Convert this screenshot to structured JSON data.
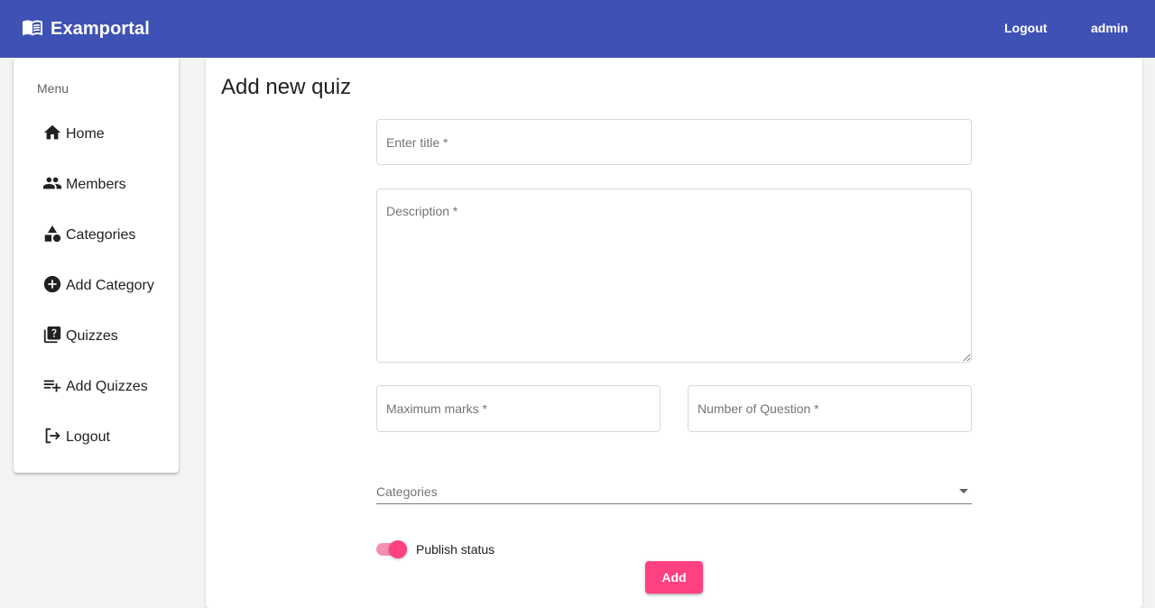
{
  "header": {
    "brand": "Examportal",
    "brand_icon": "book-icon",
    "logout": "Logout",
    "user": "admin",
    "color": "#3f51b5"
  },
  "sidebar": {
    "title": "Menu",
    "items": [
      {
        "label": "Home",
        "icon": "home-icon"
      },
      {
        "label": "Members",
        "icon": "people-icon"
      },
      {
        "label": "Categories",
        "icon": "category-icon"
      },
      {
        "label": "Add Category",
        "icon": "add-circle-icon"
      },
      {
        "label": "Quizzes",
        "icon": "quiz-icon"
      },
      {
        "label": "Add Quizzes",
        "icon": "playlist-add-icon"
      },
      {
        "label": "Logout",
        "icon": "logout-icon"
      }
    ]
  },
  "form": {
    "page_title": "Add new quiz",
    "title_placeholder": "Enter title *",
    "description_placeholder": "Description *",
    "max_marks_placeholder": "Maximum marks *",
    "num_questions_placeholder": "Number of Question *",
    "category_label": "Categories",
    "publish_label": "Publish status",
    "publish_checked": true,
    "submit_label": "Add",
    "accent": "#ff4081"
  }
}
